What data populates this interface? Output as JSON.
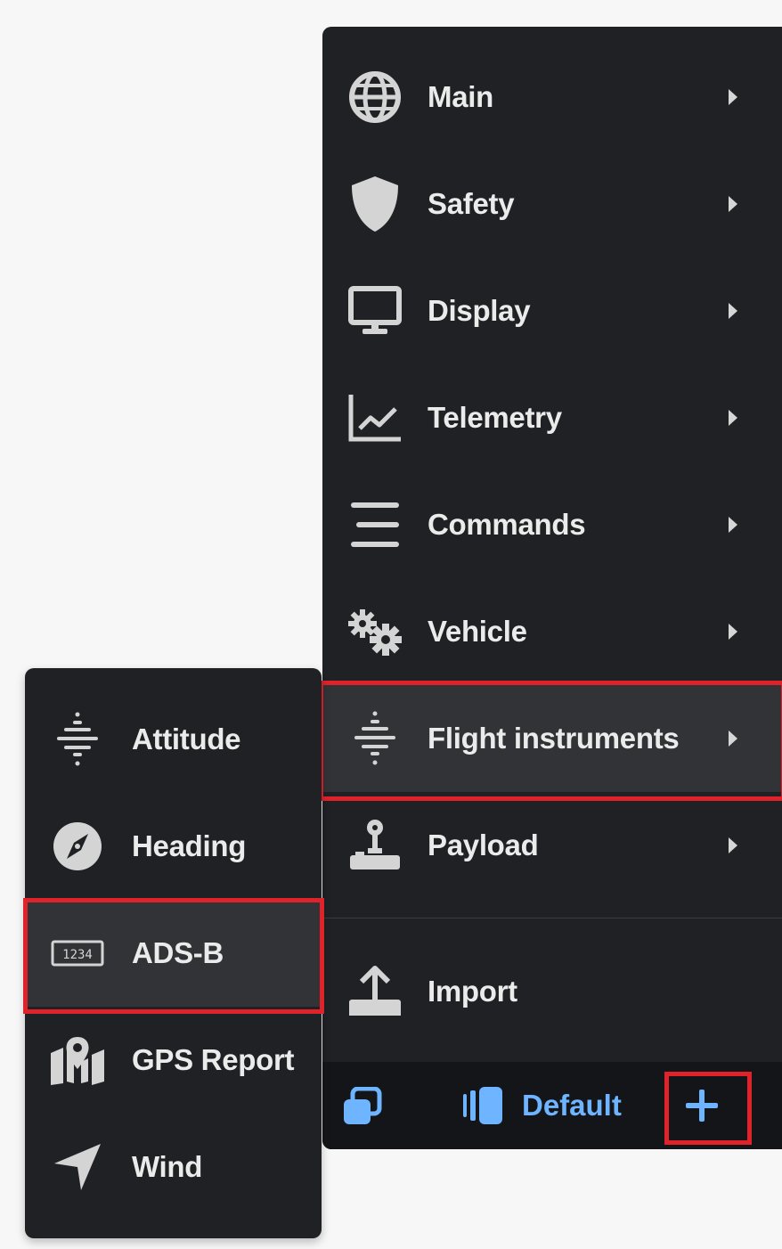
{
  "main_menu": {
    "items": [
      {
        "label": "Main",
        "icon": "globe-icon"
      },
      {
        "label": "Safety",
        "icon": "shield-icon"
      },
      {
        "label": "Display",
        "icon": "monitor-icon"
      },
      {
        "label": "Telemetry",
        "icon": "chart-line-icon"
      },
      {
        "label": "Commands",
        "icon": "lines-icon"
      },
      {
        "label": "Vehicle",
        "icon": "gears-icon"
      },
      {
        "label": "Flight instruments",
        "icon": "attitude-icon"
      },
      {
        "label": "Payload",
        "icon": "joystick-icon"
      }
    ],
    "import_label": "Import",
    "active_item": "Flight instruments"
  },
  "sub_menu": {
    "items": [
      {
        "label": "Attitude",
        "icon": "attitude-icon"
      },
      {
        "label": "Heading",
        "icon": "compass-icon"
      },
      {
        "label": "ADS-B",
        "icon": "counter-display-icon"
      },
      {
        "label": "GPS Report",
        "icon": "map-marker-icon"
      },
      {
        "label": "Wind",
        "icon": "navigation-arrow-icon"
      }
    ],
    "active_item": "ADS-B",
    "adsb_icon_text": "1234"
  },
  "footer": {
    "layout_label": "Default",
    "add_symbol": "+"
  },
  "colors": {
    "menu_bg": "#202124",
    "active_bg": "#323337",
    "footer_bg": "#141519",
    "accent": "#6eb4ff",
    "highlight": "#e0232a",
    "text": "#ebebeb"
  }
}
